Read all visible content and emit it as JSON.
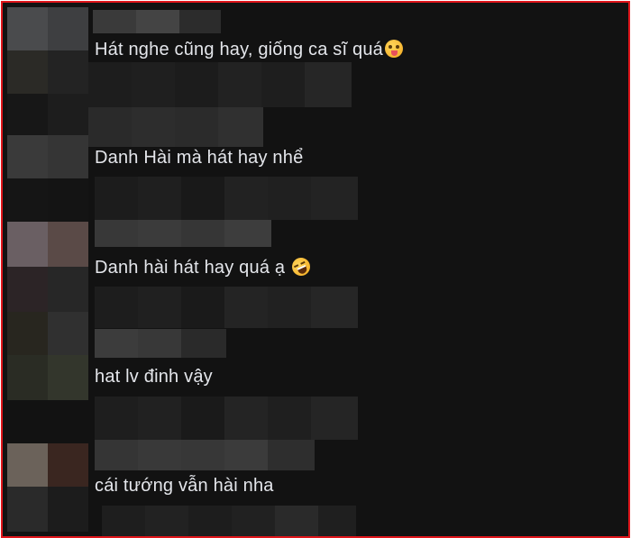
{
  "comments": [
    {
      "text": "Hát nghe cũng hay, giống ca sĩ quá",
      "emoji": "squinting-face-with-tongue-icon"
    },
    {
      "text": "Danh Hài mà hát hay nhể",
      "emoji": ""
    },
    {
      "text": "Danh hài hát hay quá ạ",
      "emoji": "rolling-on-the-floor-laughing-icon"
    },
    {
      "text": "hat lv đinh vậy",
      "emoji": ""
    },
    {
      "text": "cái tướng vẫn hài nha",
      "emoji": ""
    }
  ],
  "colors": {
    "frame_border": "#e0161b",
    "background": "#121212",
    "text": "#e4e6eb"
  }
}
